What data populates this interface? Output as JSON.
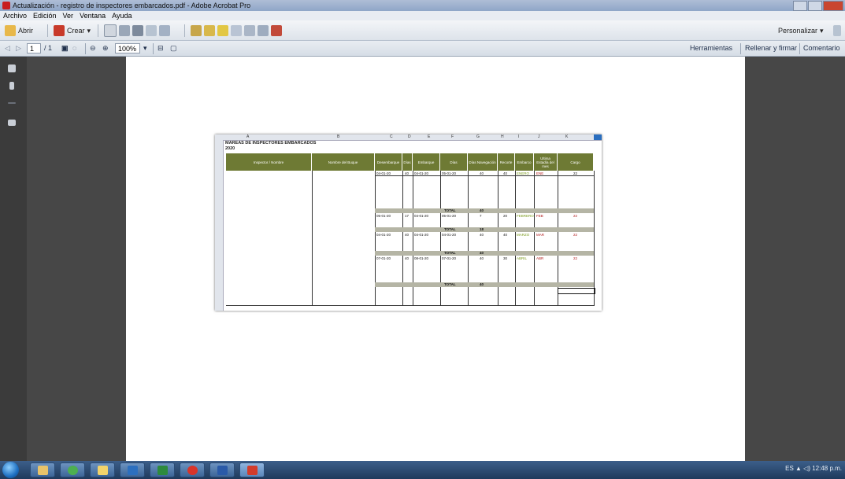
{
  "window": {
    "title": "Actualización - registro de inspectores embarcados.pdf - Adobe Acrobat Pro"
  },
  "menu": [
    "Archivo",
    "Edición",
    "Ver",
    "Ventana",
    "Ayuda"
  ],
  "toolbar": {
    "open_label": "Abrir",
    "create_label": "Crear",
    "customize_label": "Personalizar",
    "page_current": "1",
    "page_total": "/ 1",
    "zoom": "100%"
  },
  "task_panes": {
    "tools": "Herramientas",
    "fill_sign": "Rellenar y firmar",
    "comment": "Comentario"
  },
  "sheet": {
    "title": "MAREAS DE INSPECTORES EMBARCADOS",
    "year": "2020",
    "columns": [
      "Inspector / Nombre",
      "Nombre del Buque",
      "Desembarque",
      "Días",
      "Embarque",
      "Días",
      "Días Navegación",
      "Recorte",
      "Embarco",
      "Ultima Estadía del mes",
      "Cargo"
    ],
    "col_letters": [
      "A",
      "B",
      "C",
      "D",
      "E",
      "F",
      "G",
      "H",
      "I",
      "J",
      "K"
    ],
    "total_label": "TOTAL",
    "rows": [
      {
        "c": "04-01-20",
        "d": "40",
        "e": "04-01-20",
        "f": "05-01-20",
        "g": "40",
        "h": "40",
        "i": "ENERO",
        "j": "ENE",
        "k": "22"
      },
      {
        "c": "05-01-20",
        "d": "17",
        "e": "04-01-20",
        "f": "05-01-20",
        "g": "7",
        "h": "20",
        "i": "FEBRERO",
        "j": "FEB",
        "k": "22"
      },
      {
        "c": "04-01-20",
        "d": "40",
        "e": "04-01-20",
        "f": "04-01-20",
        "g": "40",
        "h": "40",
        "i": "MARZO",
        "j": "MAR",
        "k": "22"
      },
      {
        "c": "07-01-20",
        "d": "40",
        "e": "08-01-20",
        "f": "07-01-20",
        "g": "40",
        "h": "30",
        "i": "ABRIL",
        "j": "ABR",
        "k": "22"
      }
    ],
    "totals": [
      "40",
      "18",
      "40",
      "40"
    ]
  },
  "taskbar": {
    "tray_text": "ES  ▲  ◁)  12:48 p.m.",
    "apps": [
      "Explorador",
      "Chrome",
      "Archivos",
      "Outlook",
      "Excel",
      "Opera",
      "Word",
      "Acrobat"
    ]
  },
  "colors": {
    "header_green": "#6e7a34",
    "titlebar": "#8fa6c8",
    "highlight": "#7a9a1c"
  }
}
